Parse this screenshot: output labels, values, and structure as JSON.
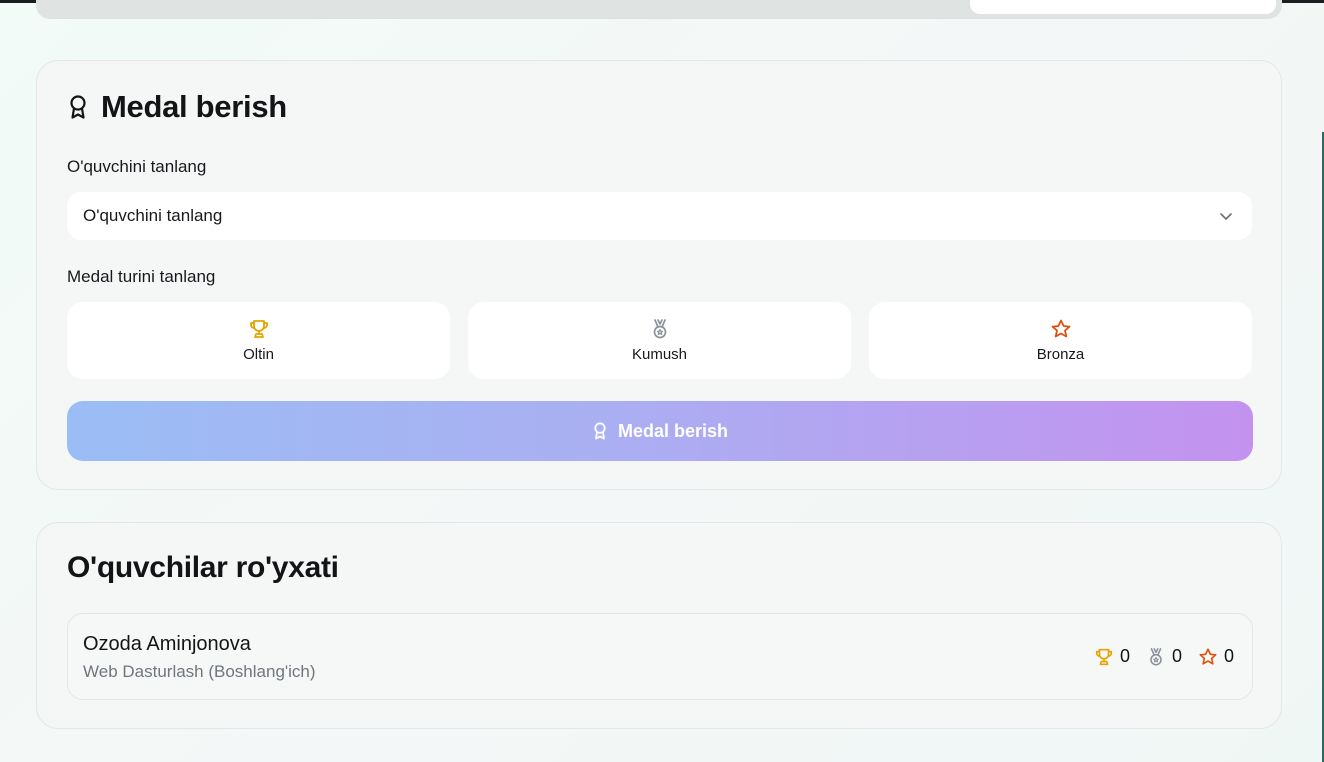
{
  "colors": {
    "gold": "#e2a500",
    "silver": "#8a9098",
    "bronze": "#e0500f"
  },
  "medal_form": {
    "title": "Medal berish",
    "title_icon": "award-ribbon-icon",
    "student_label": "O'quvchini tanlang",
    "student_select_value": "O'quvchini tanlang",
    "type_label": "Medal turini tanlang",
    "options": [
      {
        "label": "Oltin",
        "icon": "trophy-icon"
      },
      {
        "label": "Kumush",
        "icon": "medal-icon"
      },
      {
        "label": "Bronza",
        "icon": "star-icon"
      }
    ],
    "submit_label": "Medal berish"
  },
  "students": {
    "title": "O'quvchilar ro'yxati",
    "items": [
      {
        "name": "Ozoda Aminjonova",
        "course": "Web Dasturlash (Boshlang'ich)",
        "gold": "0",
        "silver": "0",
        "bronze": "0"
      }
    ]
  }
}
